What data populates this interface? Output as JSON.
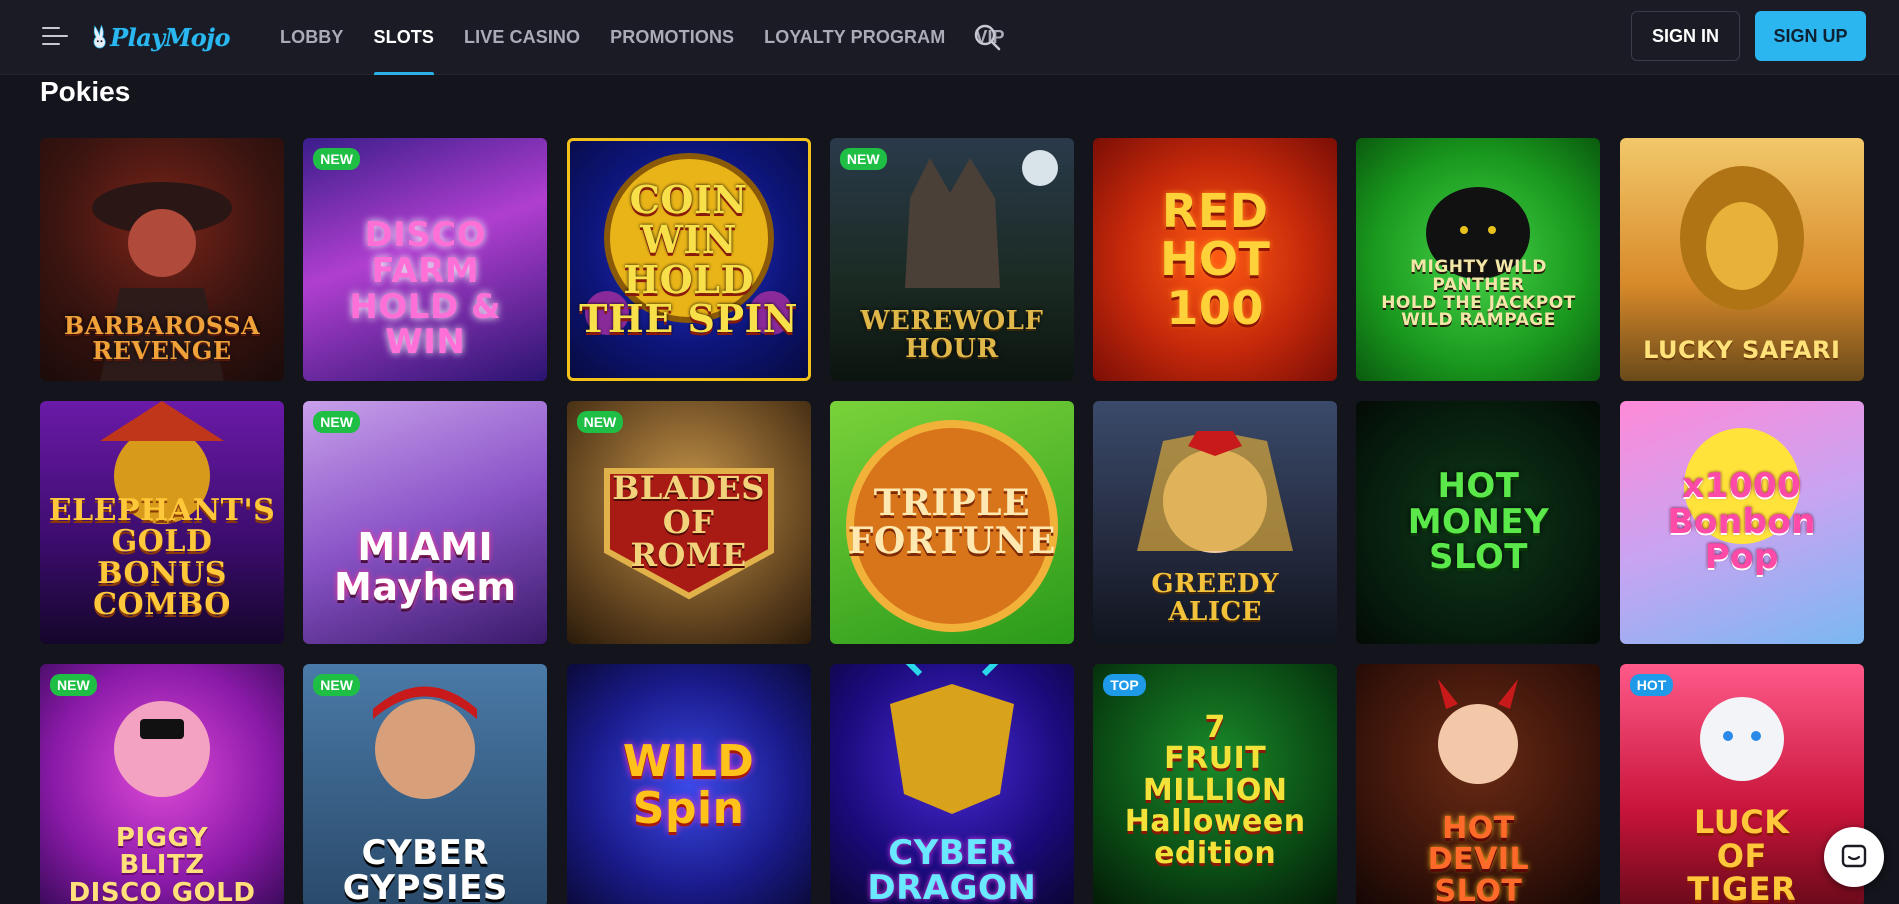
{
  "header": {
    "logo_text": "PlayMojo",
    "nav": [
      {
        "label": "LOBBY",
        "active": false
      },
      {
        "label": "SLOTS",
        "active": true
      },
      {
        "label": "LIVE CASINO",
        "active": false
      },
      {
        "label": "PROMOTIONS",
        "active": false
      },
      {
        "label": "LOYALTY PROGRAM",
        "active": false
      },
      {
        "label": "VIP",
        "active": false
      }
    ],
    "sign_in": "SIGN IN",
    "sign_up": "SIGN UP"
  },
  "section": {
    "title": "Pokies"
  },
  "colors": {
    "accent": "#2cb6ef",
    "badge_new": "#1fbf45",
    "badge_hot": "#1f9ae8",
    "selected_border": "#f2c21a"
  },
  "games": [
    {
      "title": "BARBAROSSA\nREVENGE",
      "badge": ""
    },
    {
      "title": "DISCO\nFarm\nHOLD & WIN",
      "badge": "NEW"
    },
    {
      "title": "COIN\nWIN\nHOLD THE SPIN",
      "badge": ""
    },
    {
      "title": "WEREWOLF\nHOUR",
      "badge": "NEW"
    },
    {
      "title": "RED\nHOT\n100",
      "badge": ""
    },
    {
      "title": "MIGHTY WILD\nPANTHER\nHOLD THE JACKPOT WILD RAMPAGE",
      "badge": ""
    },
    {
      "title": "LUCKY SAFARI",
      "badge": ""
    },
    {
      "title": "ELEPHANT'S\nGOLD\nBONUS COMBO",
      "badge": ""
    },
    {
      "title": "MIAMI\nMayhem",
      "badge": "NEW"
    },
    {
      "title": "BLADES\nOF\nROME",
      "badge": "NEW"
    },
    {
      "title": "TRIPLE\nFORTUNE",
      "badge": ""
    },
    {
      "title": "GREEDY ALICE",
      "badge": ""
    },
    {
      "title": "HOT\nMONEY\nSlot",
      "badge": ""
    },
    {
      "title": "x1000\nBonbon Pop",
      "badge": ""
    },
    {
      "title": "PIGGY\nBlitz\nDISCO GOLD",
      "badge": "NEW"
    },
    {
      "title": "CYBER\nGYPSIES",
      "badge": "NEW"
    },
    {
      "title": "WILD\nSpin",
      "badge": ""
    },
    {
      "title": "CYBER\nDRAGON",
      "badge": ""
    },
    {
      "title": "7\nFRUIT\nMILLION\nHalloween edition",
      "badge": "TOP"
    },
    {
      "title": "HOT\nDEVIL\nSLOT",
      "badge": ""
    },
    {
      "title": "LUCK\nOF\nTIGER",
      "badge": "HOT"
    }
  ]
}
